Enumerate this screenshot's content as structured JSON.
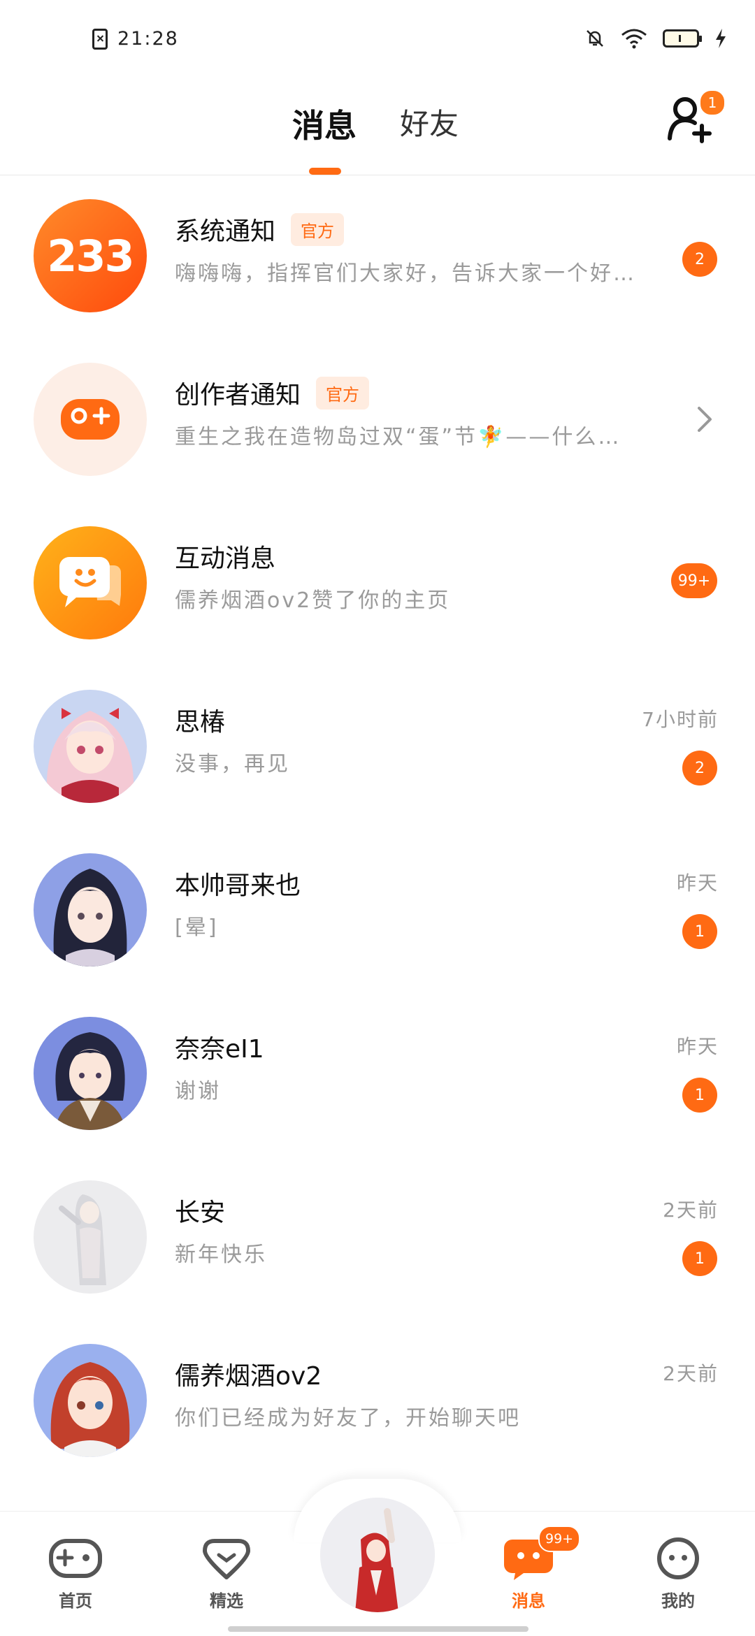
{
  "status_bar": {
    "time": "21:28"
  },
  "header": {
    "tab_messages": "消息",
    "tab_friends": "好友",
    "friend_request_count": "1"
  },
  "conversations": [
    {
      "name": "系统通知",
      "tag": "官方",
      "preview": "嗨嗨嗨，指挥官们大家好，告诉大家一个好…",
      "time": "",
      "badge": "2",
      "avatar_text": "233"
    },
    {
      "name": "创作者通知",
      "tag": "官方",
      "preview": "重生之我在造物岛过双“蛋”节🧚——什么…",
      "time": "",
      "badge": ""
    },
    {
      "name": "互动消息",
      "tag": "",
      "preview": "儒养烟酒ov2赞了你的主页",
      "time": "",
      "badge": "99+"
    },
    {
      "name": "思椿",
      "tag": "",
      "preview": "没事，再见",
      "time": "7小时前",
      "badge": "2"
    },
    {
      "name": "本帅哥来也",
      "tag": "",
      "preview": "[晕]",
      "time": "昨天",
      "badge": "1"
    },
    {
      "name": "奈奈eI1",
      "tag": "",
      "preview": "谢谢",
      "time": "昨天",
      "badge": "1"
    },
    {
      "name": "长安",
      "tag": "",
      "preview": "新年快乐",
      "time": "2天前",
      "badge": "1"
    },
    {
      "name": "儒养烟酒ov2",
      "tag": "",
      "preview": "你们已经成为好友了，开始聊天吧",
      "time": "2天前",
      "badge": ""
    }
  ],
  "bottom_nav": {
    "home": "首页",
    "featured": "精选",
    "messages": "消息",
    "messages_badge": "99+",
    "mine": "我的"
  },
  "colors": {
    "accent": "#ff6a13"
  }
}
